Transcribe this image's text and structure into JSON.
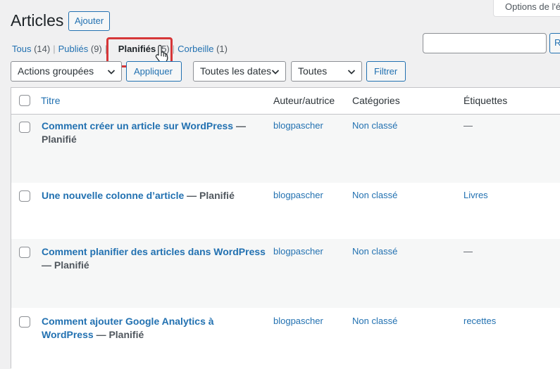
{
  "screen_options": {
    "label": "Options de l'é"
  },
  "header": {
    "title": "Articles",
    "add_label": "Ajouter"
  },
  "views": {
    "all": {
      "label": "Tous",
      "count": "(14)"
    },
    "published": {
      "label": "Publiés",
      "count": "(9)"
    },
    "scheduled": {
      "label": "Planifiés",
      "count": "(5)"
    },
    "trash": {
      "label": "Corbeille",
      "count": "(1)"
    },
    "separator": "|"
  },
  "search": {
    "value": "",
    "button_label": "R"
  },
  "toolbar": {
    "bulk_actions": "Actions groupées",
    "apply_label": "Appliquer",
    "dates_filter": "Toutes les dates",
    "category_filter": "Toutes",
    "filter_label": "Filtrer"
  },
  "table": {
    "columns": {
      "title": "Titre",
      "author": "Auteur/autrice",
      "categories": "Catégories",
      "tags": "Étiquettes"
    },
    "rows": [
      {
        "title": "Comment créer un article sur WordPress",
        "state": "— Planifié",
        "author": "blogpascher",
        "category": "Non classé",
        "tags": "—"
      },
      {
        "title": "Une nouvelle colonne d’article",
        "state": "— Planifié",
        "author": "blogpascher",
        "category": "Non classé",
        "tags": "Livres"
      },
      {
        "title": "Comment planifier des articles dans WordPress",
        "state": "— Planifié",
        "author": "blogpascher",
        "category": "Non classé",
        "tags": "—"
      },
      {
        "title": "Comment ajouter Google Analytics à WordPress",
        "state": "— Planifié",
        "author": "blogpascher",
        "category": "Non classé",
        "tags": "recettes"
      }
    ]
  },
  "colors": {
    "accent": "#2271b1",
    "highlight": "#d63638",
    "background": "#f0f0f1"
  }
}
